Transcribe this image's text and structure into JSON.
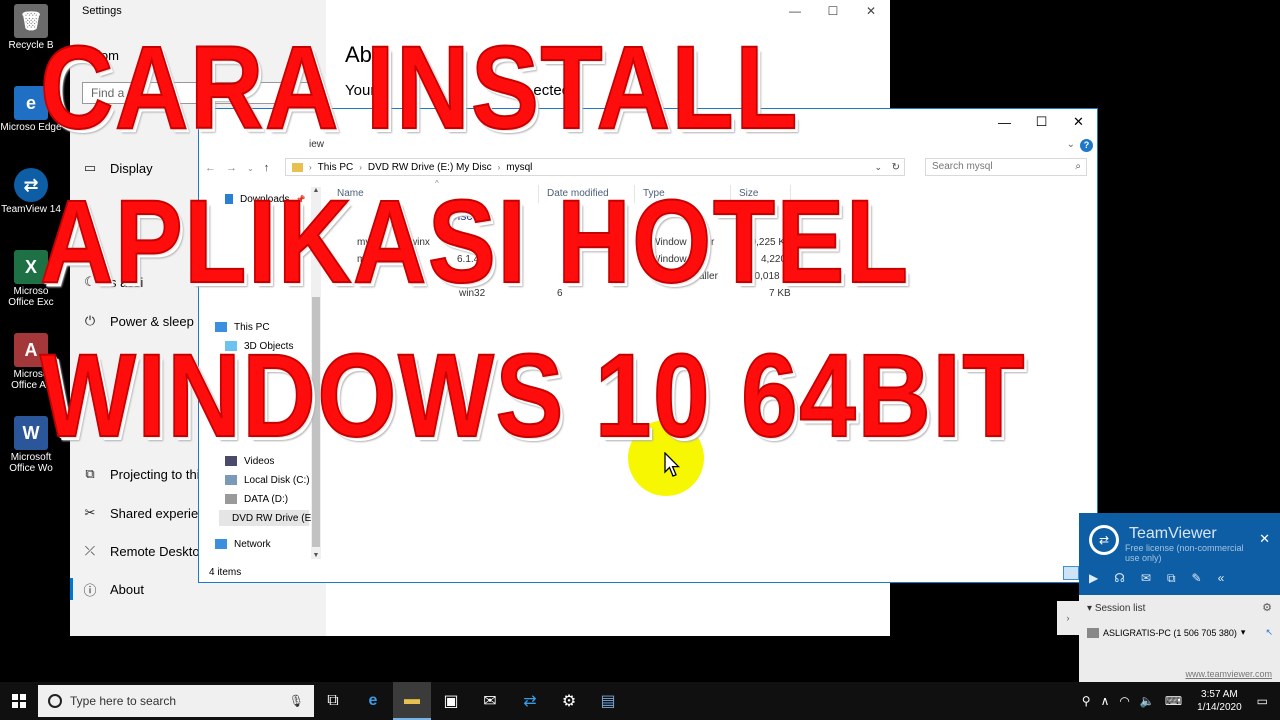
{
  "desktop": {
    "icons": [
      {
        "label": "Recycle B",
        "icon": "recycle-bin-icon",
        "color": "#6b6b6b"
      },
      {
        "label": "Microso Edge",
        "icon": "edge-icon",
        "color": "#1f6fc4"
      },
      {
        "label": "TeamView 14",
        "icon": "teamviewer-icon",
        "color": "#0e5ea5"
      },
      {
        "label": "Microso Office Exc",
        "icon": "excel-icon",
        "color": "#1e7145"
      },
      {
        "label": "Microso Office Ac",
        "icon": "access-icon",
        "color": "#a4373a"
      },
      {
        "label": "Microsoft Office Wo",
        "icon": "word-icon",
        "color": "#2b579a"
      }
    ]
  },
  "settings": {
    "title": "Settings",
    "home": "lom",
    "find_placeholder": "Find a",
    "heading": "Abo",
    "subheading_left": "Your P",
    "subheading_right": "ected",
    "nav": [
      {
        "label": "Display",
        "icon": "display-icon"
      },
      {
        "label": "s assi",
        "icon": "focus-assist-icon"
      },
      {
        "label": "Power & sleep",
        "icon": "power-icon"
      },
      {
        "label": "Projecting to this",
        "icon": "projecting-icon"
      },
      {
        "label": "Shared experienc",
        "icon": "shared-experiences-icon"
      },
      {
        "label": "Remote Desktop",
        "icon": "remote-desktop-icon"
      },
      {
        "label": "About",
        "icon": "info-icon"
      }
    ],
    "window_buttons": [
      "—",
      "☐",
      "✕"
    ]
  },
  "explorer": {
    "window_buttons": [
      "—",
      "☐",
      "✕"
    ],
    "ribbon_view": "iew",
    "address": {
      "crumbs": [
        "This PC",
        "DVD RW Drive (E:) My Disc",
        "mysql"
      ]
    },
    "search_placeholder": "Search mysql",
    "nav": [
      {
        "label": "Downloads",
        "icon": "downloads-icon"
      },
      {
        "label": "This PC",
        "icon": "this-pc-icon"
      },
      {
        "label": "3D Objects",
        "icon": "3d-objects-icon"
      },
      {
        "label": "Videos",
        "icon": "videos-icon"
      },
      {
        "label": "Local Disk (C:)",
        "icon": "local-disk-icon"
      },
      {
        "label": "DATA (D:)",
        "icon": "drive-icon"
      },
      {
        "label": "DVD RW Drive (E",
        "icon": "dvd-drive-icon"
      },
      {
        "label": "Network",
        "icon": "network-icon"
      }
    ],
    "columns": [
      "Name",
      "Date modified",
      "Type",
      "Size"
    ],
    "group_label": "Disc (",
    "files": [
      {
        "name": "my",
        "name2": "5-winx",
        "date": "M",
        "type": "Window",
        "type2": "ller",
        "size": "00,225 KB"
      },
      {
        "name": "mysql",
        "name2": "6.1.4-w",
        "date": "PM",
        "type": "Window",
        "type2": "",
        "size": "4,220 KB"
      },
      {
        "name": "",
        "name2": "win32",
        "date": "PM",
        "type": "Window",
        "type2": "aller",
        "size": "40,018 KB"
      },
      {
        "name": "",
        "name2": "win32",
        "date": "6",
        "type": "",
        "type2": "",
        "size": "7 KB"
      }
    ],
    "status": "4 items"
  },
  "overlay": {
    "line1": "CARA INSTALL",
    "line2": "APLIKASI HOTEL",
    "line3": "WINDOWS 10 64BIT",
    "color": "#ff0d0d"
  },
  "teamviewer": {
    "name": "TeamViewer",
    "license": "Free license (non-commercial use only)",
    "session_list": "Session list",
    "session": "ASLIGRATIS-PC (1 506 705 380)",
    "link": "www.teamviewer.com",
    "brand_color": "#0e5ea5"
  },
  "taskbar": {
    "search_placeholder": "Type here to search",
    "time": "3:57 AM",
    "date": "1/14/2020",
    "pinned": [
      {
        "icon": "task-view-icon",
        "glyph": "⧉"
      },
      {
        "icon": "edge-icon",
        "glyph": "e"
      },
      {
        "icon": "file-explorer-icon",
        "glyph": "▬"
      },
      {
        "icon": "store-icon",
        "glyph": "▣"
      },
      {
        "icon": "mail-icon",
        "glyph": "✉"
      },
      {
        "icon": "teamviewer-icon",
        "glyph": "⇄"
      },
      {
        "icon": "settings-gear-icon",
        "glyph": "⚙"
      },
      {
        "icon": "installer-icon",
        "glyph": "▤"
      }
    ]
  }
}
